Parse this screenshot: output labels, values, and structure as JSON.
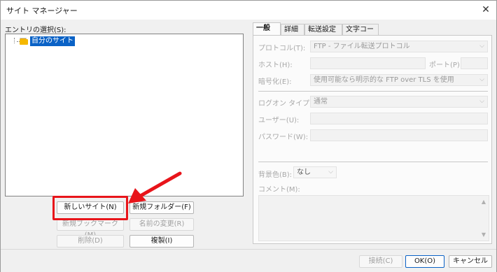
{
  "window": {
    "title": "サイト マネージャー",
    "close_icon": "✕"
  },
  "entry": {
    "label": "エントリの選択(S):",
    "items": [
      {
        "label": "自分のサイト",
        "icon": "folder-icon",
        "selected": true
      }
    ]
  },
  "left_buttons": {
    "new_site": "新しいサイト(N)",
    "new_folder": "新規フォルダー(F)",
    "new_bookmark": "新規ブックマーク(M)",
    "rename": "名前の変更(R)",
    "delete": "削除(D)",
    "duplicate": "複製(I)"
  },
  "tabs": [
    {
      "label": "一般",
      "active": true
    },
    {
      "label": "詳細"
    },
    {
      "label": "転送設定"
    },
    {
      "label": "文字コード"
    }
  ],
  "general": {
    "protocol_label": "プロトコル(T):",
    "protocol_value": "FTP - ファイル転送プロトコル",
    "host_label": "ホスト(H):",
    "host_value": "",
    "port_label": "ポート(P):",
    "port_value": "",
    "encryption_label": "暗号化(E):",
    "encryption_value": "使用可能なら明示的な FTP over TLS を使用",
    "logon_label": "ログオン タイプ(L):",
    "logon_value": "通常",
    "user_label": "ユーザー(U):",
    "user_value": "",
    "password_label": "パスワード(W):",
    "password_value": "",
    "bgcolor_label": "背景色(B):",
    "bgcolor_value": "なし",
    "comment_label": "コメント(M):",
    "comment_value": ""
  },
  "footer": {
    "connect": "接続(C)",
    "ok": "OK(O)",
    "cancel": "キャンセル"
  },
  "colors": {
    "accent": "#0a62c6",
    "annotation": "#e8141a"
  }
}
